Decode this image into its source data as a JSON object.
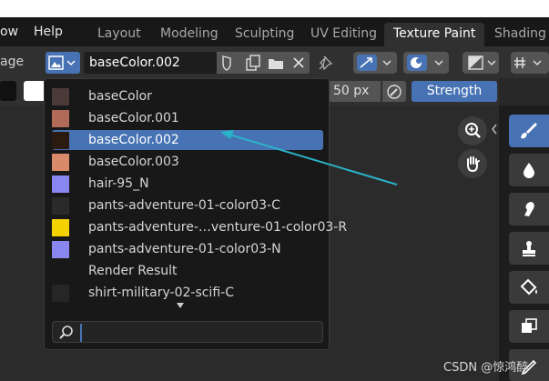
{
  "menubar": {
    "items": [
      "ow",
      "Help"
    ]
  },
  "workspace_tabs": [
    {
      "label": "Layout",
      "active": false
    },
    {
      "label": "Modeling",
      "active": false
    },
    {
      "label": "Sculpting",
      "active": false
    },
    {
      "label": "UV Editing",
      "active": false
    },
    {
      "label": "Texture Paint",
      "active": true
    },
    {
      "label": "Shading",
      "active": false
    }
  ],
  "header": {
    "left_label": "age",
    "image_name": "baseColor.002"
  },
  "tool_header": {
    "radius_value": "50 px",
    "strength_label": "Strength"
  },
  "dropdown": {
    "items": [
      {
        "label": "baseColor",
        "thumb": "#5b4a46",
        "selected": false
      },
      {
        "label": "baseColor.001",
        "thumb": "#b06a58",
        "selected": false
      },
      {
        "label": "baseColor.002",
        "thumb": "#2a1a10",
        "selected": true
      },
      {
        "label": "baseColor.003",
        "thumb": "#d98a6a",
        "selected": false
      },
      {
        "label": "hair-95_N",
        "thumb": "#8a86f0",
        "selected": false
      },
      {
        "label": "pants-adventure-01-color03-C",
        "thumb": "#2a2a2a",
        "selected": false
      },
      {
        "label": "pants-adventure-…venture-01-color03-R",
        "thumb": "#f4d100",
        "selected": false
      },
      {
        "label": "pants-adventure-01-color03-N",
        "thumb": "#8a86f0",
        "selected": false
      },
      {
        "label": "Render Result",
        "thumb": "",
        "selected": false
      },
      {
        "label": "shirt-military-02-scifi-C",
        "thumb": "#262626",
        "selected": false
      }
    ],
    "search_placeholder": ""
  },
  "watermark": "CSDN @惊鸿醉",
  "colors": {
    "accent": "#4772b3",
    "arrow": "#2ab3c8"
  }
}
